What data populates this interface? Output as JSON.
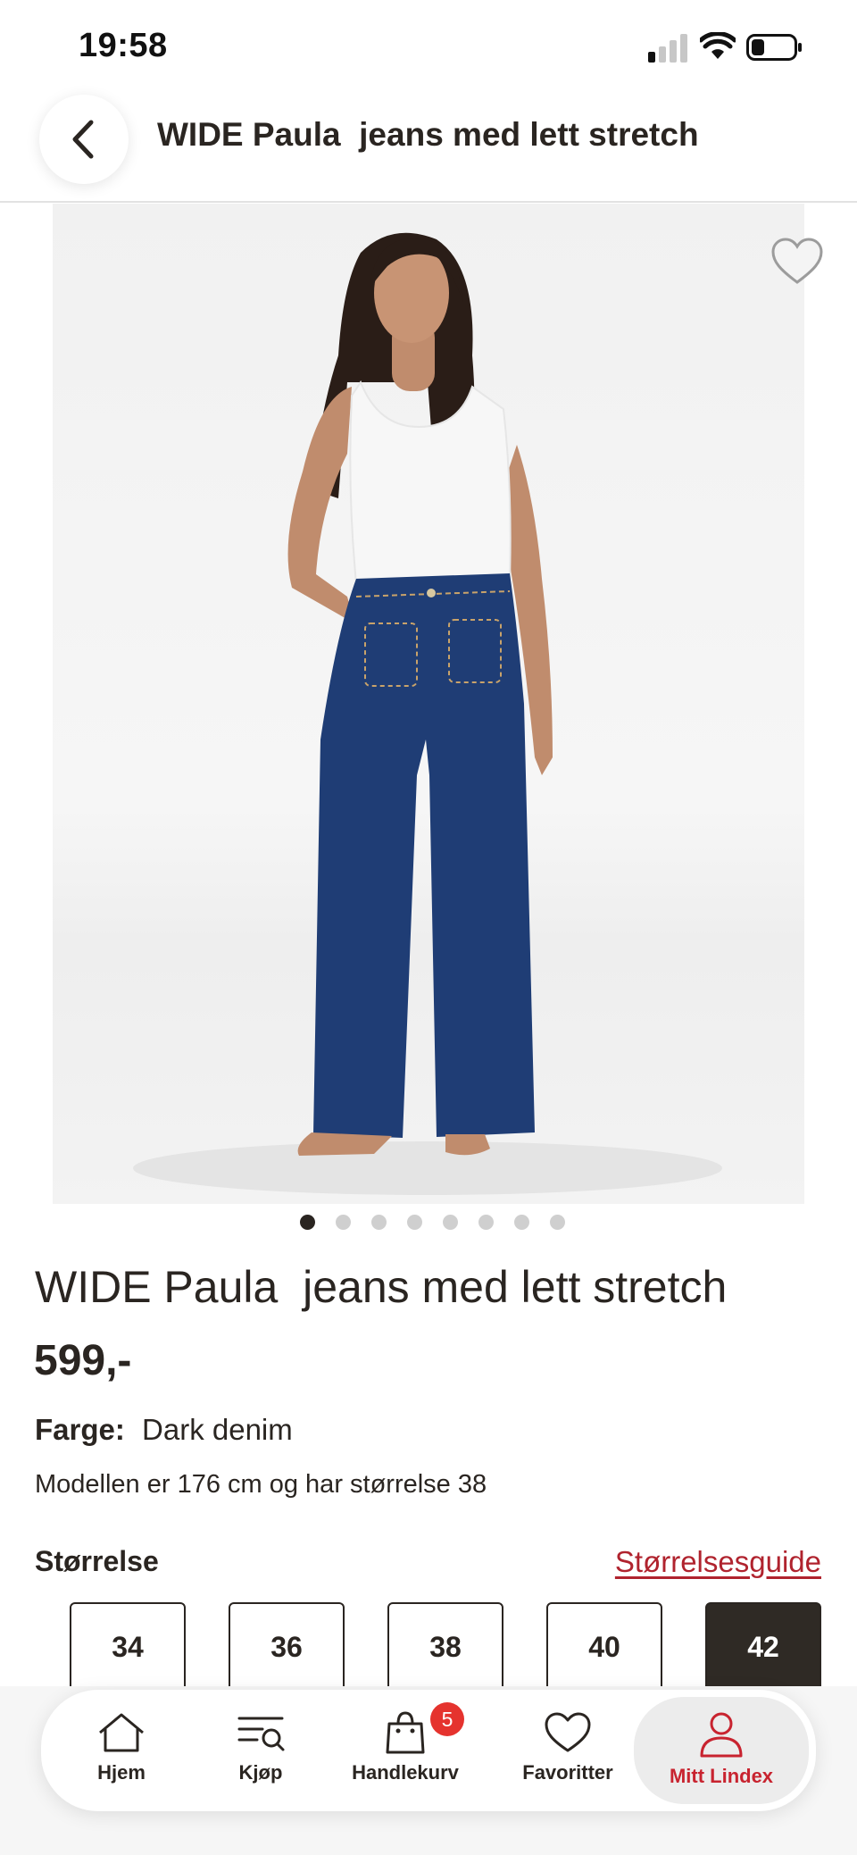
{
  "status_bar": {
    "time": "19:58"
  },
  "header": {
    "title": "WIDE Paula  jeans med lett stretch"
  },
  "gallery": {
    "image_count": 8,
    "active_index": 0
  },
  "product": {
    "title": "WIDE Paula  jeans med lett stretch",
    "price": "599,-",
    "color_label": "Farge:",
    "color_value": "Dark denim",
    "model_info": "Modellen er 176 cm og har størrelse 38"
  },
  "sizes": {
    "label": "Størrelse",
    "guide_link": "Størrelsesguide",
    "options": [
      "34",
      "36",
      "38",
      "40",
      "42"
    ],
    "selected": "42"
  },
  "tab_bar": {
    "items": [
      {
        "label": "Hjem",
        "icon": "home-icon"
      },
      {
        "label": "Kjøp",
        "icon": "search-list-icon"
      },
      {
        "label": "Handlekurv",
        "icon": "shopping-bag-icon",
        "badge": "5"
      },
      {
        "label": "Favoritter",
        "icon": "heart-icon"
      },
      {
        "label": "Mitt Lindex",
        "icon": "person-icon"
      }
    ],
    "active": "Mitt Lindex"
  },
  "colors": {
    "accent_red": "#b0232e",
    "text_dark": "#2a2521",
    "badge_red": "#e5332e"
  }
}
